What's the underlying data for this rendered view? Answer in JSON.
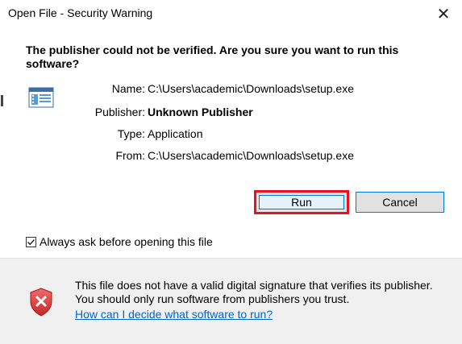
{
  "window": {
    "title": "Open File - Security Warning",
    "close_glyph": "✕"
  },
  "main": {
    "headline": "The publisher could not be verified.  Are you sure you want to run this software?",
    "file_icon": "application-window-icon",
    "fields": [
      {
        "label": "Name:",
        "value": "C:\\Users\\academic\\Downloads\\setup.exe",
        "bold": false
      },
      {
        "label": "Publisher:",
        "value": "Unknown Publisher",
        "bold": true
      },
      {
        "label": "Type:",
        "value": "Application",
        "bold": false
      },
      {
        "label": "From:",
        "value": "C:\\Users\\academic\\Downloads\\setup.exe",
        "bold": false
      }
    ],
    "buttons": {
      "run_label": "Run",
      "cancel_label": "Cancel"
    },
    "checkbox": {
      "label": "Always ask before opening this file",
      "checked": true
    }
  },
  "footer": {
    "icon": "shield-error-icon",
    "warning_text": "This file does not have a valid digital signature that verifies its publisher.  You should only run software from publishers you trust.",
    "help_link": "How can I decide what software to run?"
  },
  "colors": {
    "run_highlight": "#e81123",
    "focus_blue": "#0078d7",
    "link": "#0066cc",
    "footer_bg": "#f0f0f0",
    "shield_red": "#d32f2f"
  }
}
